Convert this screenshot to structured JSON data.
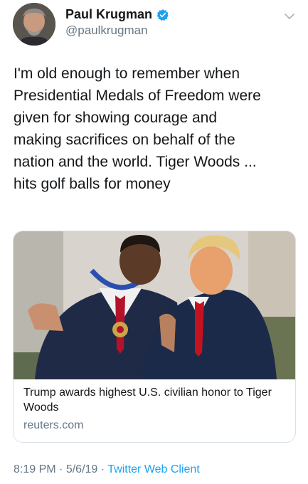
{
  "tweet": {
    "author": {
      "display_name": "Paul Krugman",
      "handle": "@paulkrugman",
      "verified": true,
      "avatar_icon": "profile-photo"
    },
    "text": "I'm old enough to remember when\nPresidential Medals of Freedom were\ngiven for showing courage and\nmaking sacrifices on behalf of the\nnation and the world. Tiger Woods ...\nhits golf balls for money",
    "card": {
      "title": "Trump awards highest U.S. civilian honor to Tiger Woods",
      "domain": "reuters.com"
    },
    "meta": {
      "time": "8:19 PM",
      "separator": "·",
      "date": "5/6/19",
      "source": "Twitter Web Client"
    }
  },
  "colors": {
    "link": "#1da1f2",
    "secondary_text": "#657786",
    "border": "#d9e1e8",
    "verified_badge": "#1da1f2"
  },
  "icons": [
    "verified-badge-icon",
    "chevron-down-icon"
  ]
}
